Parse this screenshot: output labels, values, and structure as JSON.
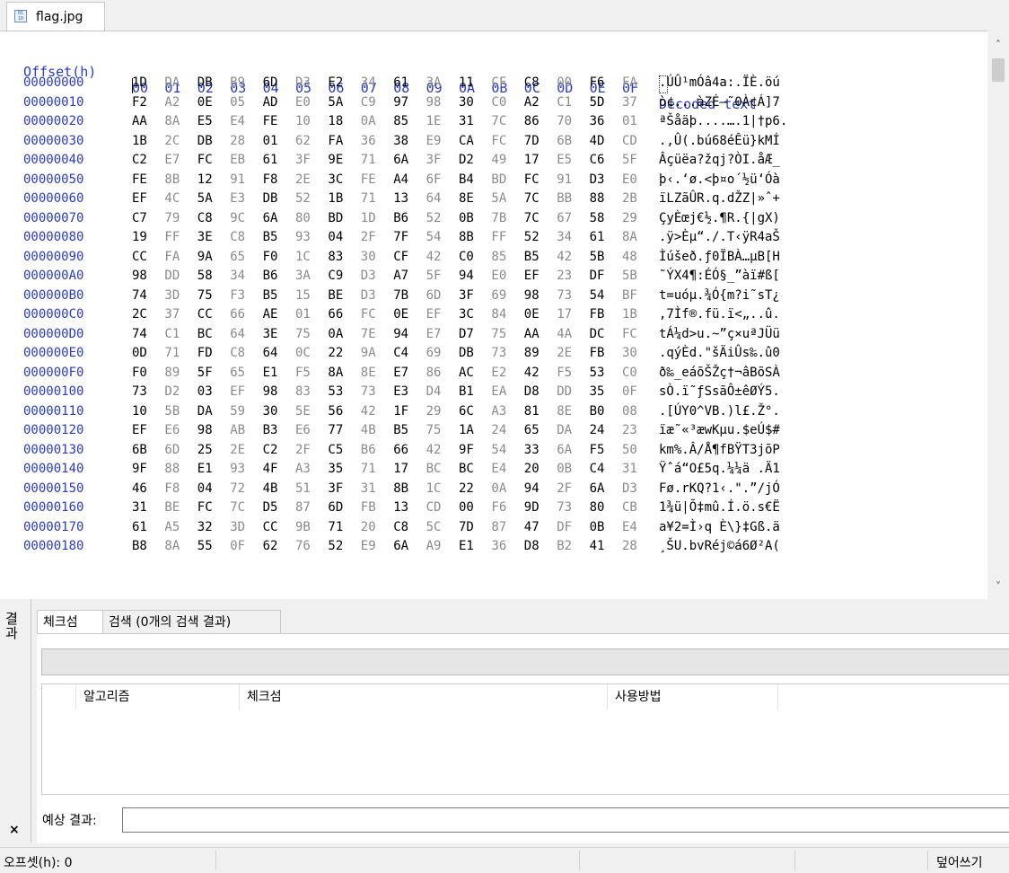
{
  "tab": {
    "icon": "binary-file-icon",
    "title": "flag.jpg"
  },
  "hex_header": {
    "offset_label": "Offset(h)",
    "columns": [
      "00",
      "01",
      "02",
      "03",
      "04",
      "05",
      "06",
      "07",
      "08",
      "09",
      "0A",
      "0B",
      "0C",
      "0D",
      "0E",
      "0F"
    ],
    "decoded_label": "Decoded text"
  },
  "rows": [
    {
      "offset": "00000000",
      "bytes": [
        "1D",
        "DA",
        "DB",
        "B9",
        "6D",
        "D3",
        "E2",
        "34",
        "61",
        "3A",
        "11",
        "CF",
        "C8",
        "00",
        "F6",
        "FA"
      ],
      "text": ".ÚÛ¹mÓâ4a:.ÏÈ.öú"
    },
    {
      "offset": "00000010",
      "bytes": [
        "F2",
        "A2",
        "0E",
        "05",
        "AD",
        "E0",
        "5A",
        "C9",
        "97",
        "98",
        "30",
        "C0",
        "A2",
        "C1",
        "5D",
        "37"
      ],
      "text": "ò¢...àZÉ—˜0À¢Á]7"
    },
    {
      "offset": "00000020",
      "bytes": [
        "AA",
        "8A",
        "E5",
        "E4",
        "FE",
        "10",
        "18",
        "0A",
        "85",
        "1E",
        "31",
        "7C",
        "86",
        "70",
        "36",
        "01"
      ],
      "text": "ªŠåäþ....….1|†p6."
    },
    {
      "offset": "00000030",
      "bytes": [
        "1B",
        "2C",
        "DB",
        "28",
        "01",
        "62",
        "FA",
        "36",
        "38",
        "E9",
        "CA",
        "FC",
        "7D",
        "6B",
        "4D",
        "CD"
      ],
      "text": ".,Û(.bú68éÊü}kMÍ"
    },
    {
      "offset": "00000040",
      "bytes": [
        "C2",
        "E7",
        "FC",
        "EB",
        "61",
        "3F",
        "9E",
        "71",
        "6A",
        "3F",
        "D2",
        "49",
        "17",
        "E5",
        "C6",
        "5F"
      ],
      "text": "Âçüëa?žqj?ÒI.åÆ_"
    },
    {
      "offset": "00000050",
      "bytes": [
        "FE",
        "8B",
        "12",
        "91",
        "F8",
        "2E",
        "3C",
        "FE",
        "A4",
        "6F",
        "B4",
        "BD",
        "FC",
        "91",
        "D3",
        "E0"
      ],
      "text": "þ‹.‘ø.<þ¤o´½ü‘Óà"
    },
    {
      "offset": "00000060",
      "bytes": [
        "EF",
        "4C",
        "5A",
        "E3",
        "DB",
        "52",
        "1B",
        "71",
        "13",
        "64",
        "8E",
        "5A",
        "7C",
        "BB",
        "88",
        "2B"
      ],
      "text": "ïLZãÛR.q.dŽZ|»ˆ+"
    },
    {
      "offset": "00000070",
      "bytes": [
        "C7",
        "79",
        "C8",
        "9C",
        "6A",
        "80",
        "BD",
        "1D",
        "B6",
        "52",
        "0B",
        "7B",
        "7C",
        "67",
        "58",
        "29"
      ],
      "text": "ÇyÈœj€½.¶R.{|gX)"
    },
    {
      "offset": "00000080",
      "bytes": [
        "19",
        "FF",
        "3E",
        "C8",
        "B5",
        "93",
        "04",
        "2F",
        "7F",
        "54",
        "8B",
        "FF",
        "52",
        "34",
        "61",
        "8A"
      ],
      "text": ".ÿ>Èµ“./.T‹ÿR4aŠ"
    },
    {
      "offset": "00000090",
      "bytes": [
        "CC",
        "FA",
        "9A",
        "65",
        "F0",
        "1C",
        "83",
        "30",
        "CF",
        "42",
        "C0",
        "85",
        "B5",
        "42",
        "5B",
        "48"
      ],
      "text": "Ìúšeð.ƒ0ÏBÀ…µB[H"
    },
    {
      "offset": "000000A0",
      "bytes": [
        "98",
        "DD",
        "58",
        "34",
        "B6",
        "3A",
        "C9",
        "D3",
        "A7",
        "5F",
        "94",
        "E0",
        "EF",
        "23",
        "DF",
        "5B"
      ],
      "text": "˜ÝX4¶:ÉÓ§_”àï#ß["
    },
    {
      "offset": "000000B0",
      "bytes": [
        "74",
        "3D",
        "75",
        "F3",
        "B5",
        "15",
        "BE",
        "D3",
        "7B",
        "6D",
        "3F",
        "69",
        "98",
        "73",
        "54",
        "BF"
      ],
      "text": "t=uóµ.¾Ó{m?i˜sT¿"
    },
    {
      "offset": "000000C0",
      "bytes": [
        "2C",
        "37",
        "CC",
        "66",
        "AE",
        "01",
        "66",
        "FC",
        "0E",
        "EF",
        "3C",
        "84",
        "0E",
        "17",
        "FB",
        "1B"
      ],
      "text": ",7Ìf®.fü.ï<„..û."
    },
    {
      "offset": "000000D0",
      "bytes": [
        "74",
        "C1",
        "BC",
        "64",
        "3E",
        "75",
        "0A",
        "7E",
        "94",
        "E7",
        "D7",
        "75",
        "AA",
        "4A",
        "DC",
        "FC"
      ],
      "text": "tÁ¼d>u.~”ç×uªJÜü"
    },
    {
      "offset": "000000E0",
      "bytes": [
        "0D",
        "71",
        "FD",
        "C8",
        "64",
        "0C",
        "22",
        "9A",
        "C4",
        "69",
        "DB",
        "73",
        "89",
        "2E",
        "FB",
        "30"
      ],
      "text": ".qýÈd.\"šÄiÛs‰.û0"
    },
    {
      "offset": "000000F0",
      "bytes": [
        "F0",
        "89",
        "5F",
        "65",
        "E1",
        "F5",
        "8A",
        "8E",
        "E7",
        "86",
        "AC",
        "E2",
        "42",
        "F5",
        "53",
        "C0"
      ],
      "text": "ð‰_eáõŠŽç†¬âBõSÀ"
    },
    {
      "offset": "00000100",
      "bytes": [
        "73",
        "D2",
        "03",
        "EF",
        "98",
        "83",
        "53",
        "73",
        "E3",
        "D4",
        "B1",
        "EA",
        "D8",
        "DD",
        "35",
        "0F"
      ],
      "text": "sÒ.ï˜ƒSsãÔ±êØÝ5."
    },
    {
      "offset": "00000110",
      "bytes": [
        "10",
        "5B",
        "DA",
        "59",
        "30",
        "5E",
        "56",
        "42",
        "1F",
        "29",
        "6C",
        "A3",
        "81",
        "8E",
        "B0",
        "08"
      ],
      "text": ".[ÚY0^VB.)l£.Ž°."
    },
    {
      "offset": "00000120",
      "bytes": [
        "EF",
        "E6",
        "98",
        "AB",
        "B3",
        "E6",
        "77",
        "4B",
        "B5",
        "75",
        "1A",
        "24",
        "65",
        "DA",
        "24",
        "23"
      ],
      "text": "ïæ˜«³æwKµu.$eÚ$#"
    },
    {
      "offset": "00000130",
      "bytes": [
        "6B",
        "6D",
        "25",
        "2E",
        "C2",
        "2F",
        "C5",
        "B6",
        "66",
        "42",
        "9F",
        "54",
        "33",
        "6A",
        "F5",
        "50"
      ],
      "text": "km%.Â/Å¶fBŸT3jõP"
    },
    {
      "offset": "00000140",
      "bytes": [
        "9F",
        "88",
        "E1",
        "93",
        "4F",
        "A3",
        "35",
        "71",
        "17",
        "BC",
        "BC",
        "E4",
        "20",
        "0B",
        "C4",
        "31"
      ],
      "text": "Ÿˆá“O£5q.¼¼ä .Ä1"
    },
    {
      "offset": "00000150",
      "bytes": [
        "46",
        "F8",
        "04",
        "72",
        "4B",
        "51",
        "3F",
        "31",
        "8B",
        "1C",
        "22",
        "0A",
        "94",
        "2F",
        "6A",
        "D3"
      ],
      "text": "Fø.rKQ?1‹.\".”/jÓ"
    },
    {
      "offset": "00000160",
      "bytes": [
        "31",
        "BE",
        "FC",
        "7C",
        "D5",
        "87",
        "6D",
        "FB",
        "13",
        "CD",
        "00",
        "F6",
        "9D",
        "73",
        "80",
        "CB"
      ],
      "text": "1¾ü|Õ‡mû.Í.ö.s€Ë"
    },
    {
      "offset": "00000170",
      "bytes": [
        "61",
        "A5",
        "32",
        "3D",
        "CC",
        "9B",
        "71",
        "20",
        "C8",
        "5C",
        "7D",
        "87",
        "47",
        "DF",
        "0B",
        "E4"
      ],
      "text": "a¥2=Ì›q È\\}‡Gß.ä"
    },
    {
      "offset": "00000180",
      "bytes": [
        "B8",
        "8A",
        "55",
        "0F",
        "62",
        "76",
        "52",
        "E9",
        "6A",
        "A9",
        "E1",
        "36",
        "D8",
        "B2",
        "41",
        "28"
      ],
      "text": "¸ŠU.bvRéj©á6Ø²A("
    }
  ],
  "result_panel": {
    "side_label": "결과",
    "tabs": [
      "체크섬",
      "검색 (0개의 검색 결과)"
    ],
    "progress": 0,
    "columns": [
      "알고리즘",
      "체크섬",
      "사용방법"
    ],
    "expected_label": "예상 결과:",
    "expected_value": ""
  },
  "status": {
    "offset": "오프셋(h): 0",
    "mode": "덮어쓰기"
  }
}
